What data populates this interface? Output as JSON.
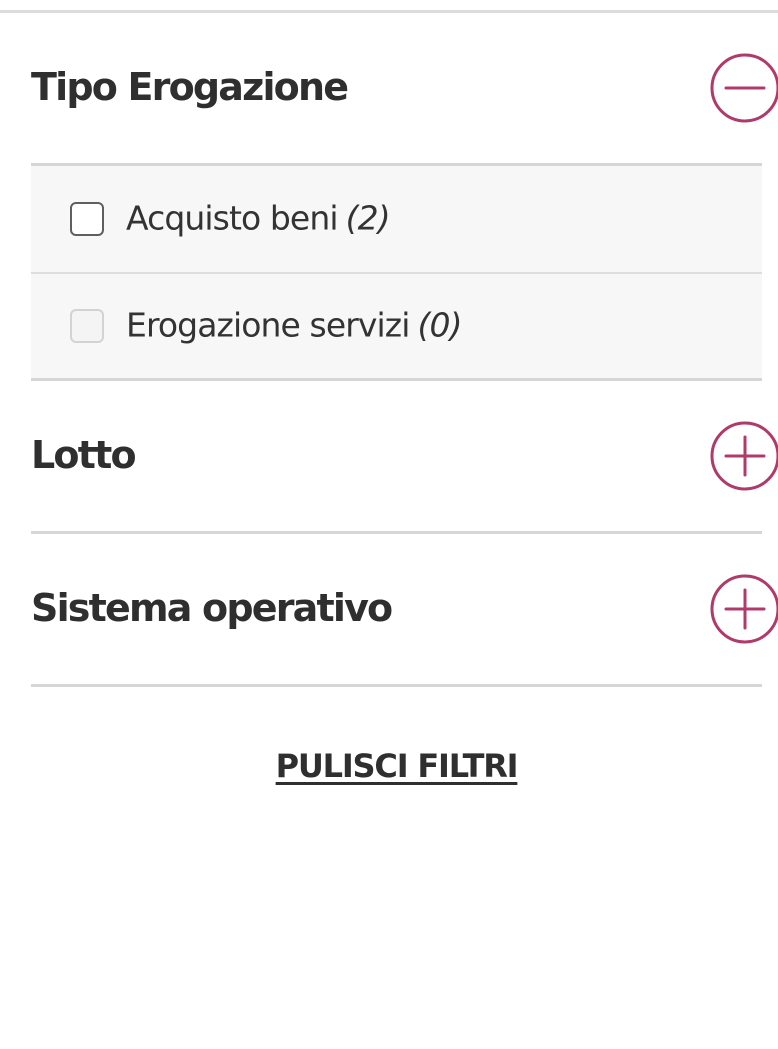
{
  "filters": {
    "sections": [
      {
        "title": "Tipo Erogazione",
        "state": "expanded",
        "toggle_icon": "minus-circle-icon",
        "options": [
          {
            "label": "Acquisto beni",
            "count": "(2)",
            "checked": false,
            "disabled": false
          },
          {
            "label": "Erogazione servizi",
            "count": "(0)",
            "checked": false,
            "disabled": true
          }
        ]
      },
      {
        "title": "Lotto",
        "state": "collapsed",
        "toggle_icon": "plus-circle-icon"
      },
      {
        "title": "Sistema operativo",
        "state": "collapsed",
        "toggle_icon": "plus-circle-icon"
      }
    ],
    "clear_label": "PULISCI FILTRI"
  },
  "colors": {
    "accent": "#b03a6a",
    "divider": "#d6d6d6",
    "options_background": "#f7f7f7",
    "text": "#333333"
  }
}
